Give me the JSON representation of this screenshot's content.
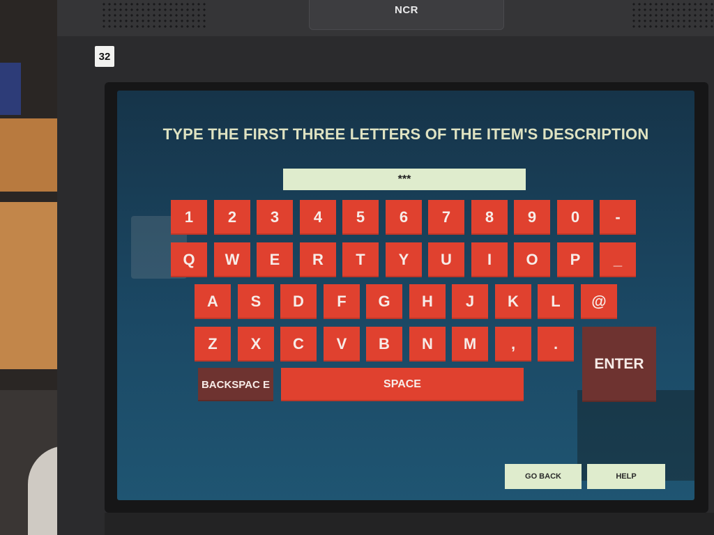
{
  "device": {
    "brand": "NCR",
    "station_number": "32"
  },
  "screen": {
    "prompt": "TYPE THE FIRST THREE LETTERS OF THE ITEM'S DESCRIPTION",
    "entry_value": "***"
  },
  "keyboard": {
    "rows": [
      [
        "1",
        "2",
        "3",
        "4",
        "5",
        "6",
        "7",
        "8",
        "9",
        "0",
        "-"
      ],
      [
        "Q",
        "W",
        "E",
        "R",
        "T",
        "Y",
        "U",
        "I",
        "O",
        "P",
        "_"
      ],
      [
        "A",
        "S",
        "D",
        "F",
        "G",
        "H",
        "J",
        "K",
        "L",
        "@"
      ],
      [
        "Z",
        "X",
        "C",
        "V",
        "B",
        "N",
        "M",
        ",",
        "."
      ]
    ],
    "backspace_label": "BACKSPAC E",
    "space_label": "SPACE",
    "enter_label": "ENTER"
  },
  "buttons": {
    "go_back": "GO BACK",
    "help": "HELP"
  },
  "colors": {
    "key": "#e0412f",
    "key_dark": "#6e3330",
    "entry_bg": "#dfeccd",
    "screen_bg": "#1b4864"
  }
}
